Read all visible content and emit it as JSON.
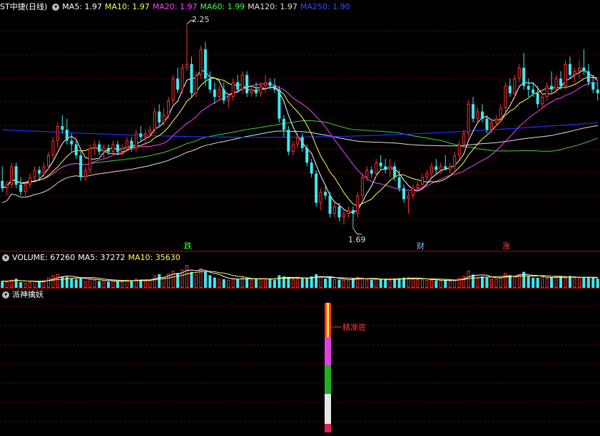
{
  "price": {
    "title": "ST中捷(日线)",
    "ma": [
      {
        "label": "MA5: 1.97",
        "color": "#ffffff"
      },
      {
        "label": "MA10: 1.97",
        "color": "#ffff55"
      },
      {
        "label": "MA20: 1.97",
        "color": "#ff40ff"
      },
      {
        "label": "MA60: 1.99",
        "color": "#40ff40"
      },
      {
        "label": "MA120: 1.97",
        "color": "#e0e0e0"
      },
      {
        "label": "MA250: 1.90",
        "color": "#2030ff"
      }
    ],
    "high_label": "2.25",
    "low_label": "1.69",
    "events": [
      "跌",
      "财",
      "涨"
    ]
  },
  "volume": {
    "label": "VOLUME: 67260",
    "ma5": "MA5: 37272",
    "ma10": "MA10: 35630"
  },
  "indicator": {
    "title": "派神擒妖",
    "annotation": "精准底"
  },
  "colors": {
    "up": "#ff3030",
    "down": "#40e8f0",
    "grid": "#8b0000",
    "divider": "#b00000"
  },
  "chart_data": {
    "type": "candlestick",
    "ylim": [
      1.66,
      2.28
    ],
    "candles": [
      [
        1.82,
        1.86,
        1.79,
        1.8
      ],
      [
        1.8,
        1.82,
        1.78,
        1.81
      ],
      [
        1.81,
        1.87,
        1.8,
        1.86
      ],
      [
        1.86,
        1.87,
        1.8,
        1.81
      ],
      [
        1.81,
        1.83,
        1.78,
        1.79
      ],
      [
        1.79,
        1.82,
        1.78,
        1.81
      ],
      [
        1.81,
        1.84,
        1.8,
        1.83
      ],
      [
        1.83,
        1.86,
        1.82,
        1.85
      ],
      [
        1.85,
        1.86,
        1.82,
        1.84
      ],
      [
        1.84,
        1.87,
        1.83,
        1.86
      ],
      [
        1.86,
        1.9,
        1.85,
        1.89
      ],
      [
        1.89,
        1.94,
        1.88,
        1.93
      ],
      [
        1.93,
        1.98,
        1.91,
        1.97
      ],
      [
        1.97,
        2.0,
        1.95,
        1.96
      ],
      [
        1.96,
        1.99,
        1.92,
        1.93
      ],
      [
        1.93,
        1.95,
        1.9,
        1.92
      ],
      [
        1.92,
        1.93,
        1.88,
        1.89
      ],
      [
        1.89,
        1.9,
        1.82,
        1.83
      ],
      [
        1.83,
        1.86,
        1.82,
        1.85
      ],
      [
        1.85,
        1.92,
        1.84,
        1.91
      ],
      [
        1.91,
        1.93,
        1.89,
        1.92
      ],
      [
        1.92,
        1.93,
        1.89,
        1.9
      ],
      [
        1.9,
        1.92,
        1.88,
        1.91
      ],
      [
        1.91,
        1.92,
        1.89,
        1.9
      ],
      [
        1.9,
        1.93,
        1.89,
        1.92
      ],
      [
        1.92,
        1.93,
        1.89,
        1.9
      ],
      [
        1.9,
        1.92,
        1.89,
        1.91
      ],
      [
        1.91,
        1.94,
        1.9,
        1.93
      ],
      [
        1.93,
        1.94,
        1.9,
        1.91
      ],
      [
        1.91,
        1.96,
        1.9,
        1.95
      ],
      [
        1.95,
        1.97,
        1.93,
        1.94
      ],
      [
        1.94,
        1.96,
        1.92,
        1.95
      ],
      [
        1.95,
        1.97,
        1.94,
        1.96
      ],
      [
        1.96,
        2.02,
        1.95,
        2.01
      ],
      [
        2.01,
        2.03,
        1.97,
        1.98
      ],
      [
        1.98,
        2.02,
        1.97,
        2.0
      ],
      [
        2.0,
        2.05,
        1.99,
        2.04
      ],
      [
        2.04,
        2.11,
        2.03,
        2.1
      ],
      [
        2.1,
        2.13,
        2.06,
        2.07
      ],
      [
        2.07,
        2.14,
        2.06,
        2.13
      ],
      [
        2.13,
        2.25,
        2.12,
        2.14
      ],
      [
        2.14,
        2.16,
        2.05,
        2.06
      ],
      [
        2.06,
        2.12,
        2.05,
        2.11
      ],
      [
        2.11,
        2.19,
        2.1,
        2.18
      ],
      [
        2.18,
        2.2,
        2.08,
        2.1
      ],
      [
        2.1,
        2.12,
        2.06,
        2.07
      ],
      [
        2.07,
        2.09,
        2.03,
        2.05
      ],
      [
        2.05,
        2.08,
        2.04,
        2.07
      ],
      [
        2.07,
        2.09,
        2.03,
        2.04
      ],
      [
        2.04,
        2.06,
        2.02,
        2.05
      ],
      [
        2.05,
        2.1,
        2.04,
        2.09
      ],
      [
        2.09,
        2.11,
        2.06,
        2.07
      ],
      [
        2.07,
        2.12,
        2.06,
        2.11
      ],
      [
        2.11,
        2.12,
        2.05,
        2.06
      ],
      [
        2.06,
        2.08,
        2.05,
        2.07
      ],
      [
        2.07,
        2.09,
        2.05,
        2.06
      ],
      [
        2.06,
        2.09,
        2.05,
        2.08
      ],
      [
        2.08,
        2.11,
        2.06,
        2.09
      ],
      [
        2.09,
        2.1,
        2.07,
        2.08
      ],
      [
        2.08,
        2.1,
        2.06,
        2.07
      ],
      [
        2.07,
        2.08,
        1.98,
        1.99
      ],
      [
        1.99,
        2.0,
        1.94,
        1.96
      ],
      [
        1.96,
        1.97,
        1.89,
        1.9
      ],
      [
        1.9,
        1.93,
        1.89,
        1.92
      ],
      [
        1.92,
        1.95,
        1.91,
        1.94
      ],
      [
        1.94,
        1.95,
        1.9,
        1.91
      ],
      [
        1.91,
        1.92,
        1.86,
        1.87
      ],
      [
        1.87,
        1.88,
        1.83,
        1.84
      ],
      [
        1.84,
        1.85,
        1.75,
        1.76
      ],
      [
        1.76,
        1.8,
        1.74,
        1.79
      ],
      [
        1.79,
        1.81,
        1.77,
        1.78
      ],
      [
        1.78,
        1.79,
        1.72,
        1.73
      ],
      [
        1.73,
        1.76,
        1.72,
        1.75
      ],
      [
        1.75,
        1.76,
        1.71,
        1.72
      ],
      [
        1.72,
        1.74,
        1.7,
        1.73
      ],
      [
        1.73,
        1.75,
        1.72,
        1.74
      ],
      [
        1.74,
        1.75,
        1.69,
        1.73
      ],
      [
        1.73,
        1.79,
        1.72,
        1.78
      ],
      [
        1.78,
        1.84,
        1.77,
        1.83
      ],
      [
        1.83,
        1.86,
        1.82,
        1.85
      ],
      [
        1.85,
        1.86,
        1.83,
        1.84
      ],
      [
        1.84,
        1.88,
        1.83,
        1.87
      ],
      [
        1.87,
        1.89,
        1.85,
        1.86
      ],
      [
        1.86,
        1.88,
        1.84,
        1.85
      ],
      [
        1.85,
        1.88,
        1.83,
        1.86
      ],
      [
        1.86,
        1.87,
        1.82,
        1.83
      ],
      [
        1.83,
        1.85,
        1.79,
        1.8
      ],
      [
        1.8,
        1.81,
        1.76,
        1.77
      ],
      [
        1.77,
        1.79,
        1.73,
        1.78
      ],
      [
        1.78,
        1.81,
        1.77,
        1.8
      ],
      [
        1.8,
        1.82,
        1.79,
        1.81
      ],
      [
        1.81,
        1.84,
        1.8,
        1.83
      ],
      [
        1.83,
        1.85,
        1.82,
        1.84
      ],
      [
        1.84,
        1.87,
        1.83,
        1.86
      ],
      [
        1.86,
        1.88,
        1.84,
        1.85
      ],
      [
        1.85,
        1.87,
        1.84,
        1.86
      ],
      [
        1.86,
        1.89,
        1.85,
        1.85
      ],
      [
        1.85,
        1.87,
        1.84,
        1.86
      ],
      [
        1.86,
        1.9,
        1.85,
        1.89
      ],
      [
        1.89,
        1.93,
        1.88,
        1.92
      ],
      [
        1.92,
        1.96,
        1.91,
        1.95
      ],
      [
        1.95,
        2.04,
        1.94,
        2.03
      ],
      [
        2.03,
        2.05,
        1.98,
        1.99
      ],
      [
        1.99,
        2.02,
        1.98,
        2.01
      ],
      [
        2.01,
        2.03,
        1.98,
        1.99
      ],
      [
        1.99,
        2.0,
        1.95,
        1.96
      ],
      [
        1.96,
        1.99,
        1.95,
        1.98
      ],
      [
        1.98,
        2.0,
        1.97,
        1.99
      ],
      [
        1.99,
        2.03,
        1.98,
        2.02
      ],
      [
        2.02,
        2.09,
        2.01,
        2.08
      ],
      [
        2.08,
        2.1,
        2.05,
        2.06
      ],
      [
        2.06,
        2.11,
        2.05,
        2.1
      ],
      [
        2.1,
        2.14,
        2.09,
        2.13
      ],
      [
        2.13,
        2.17,
        2.07,
        2.08
      ],
      [
        2.08,
        2.1,
        2.05,
        2.07
      ],
      [
        2.07,
        2.09,
        2.05,
        2.06
      ],
      [
        2.06,
        2.08,
        2.02,
        2.03
      ],
      [
        2.03,
        2.06,
        2.02,
        2.05
      ],
      [
        2.05,
        2.09,
        2.04,
        2.08
      ],
      [
        2.08,
        2.12,
        2.06,
        2.07
      ],
      [
        2.07,
        2.11,
        2.06,
        2.1
      ],
      [
        2.1,
        2.12,
        2.07,
        2.08
      ],
      [
        2.08,
        2.15,
        2.07,
        2.14
      ],
      [
        2.14,
        2.16,
        2.1,
        2.11
      ],
      [
        2.11,
        2.13,
        2.09,
        2.12
      ],
      [
        2.12,
        2.15,
        2.1,
        2.13
      ],
      [
        2.13,
        2.18,
        2.11,
        2.12
      ],
      [
        2.12,
        2.14,
        2.08,
        2.09
      ],
      [
        2.09,
        2.11,
        2.06,
        2.07
      ],
      [
        2.07,
        2.09,
        2.04,
        2.06
      ]
    ],
    "volume_max": 100,
    "volume": [
      30,
      28,
      35,
      40,
      25,
      22,
      26,
      30,
      28,
      32,
      45,
      55,
      60,
      50,
      48,
      42,
      38,
      45,
      30,
      40,
      35,
      30,
      28,
      27,
      32,
      30,
      28,
      35,
      30,
      40,
      36,
      32,
      34,
      55,
      60,
      48,
      62,
      75,
      65,
      80,
      100,
      70,
      60,
      85,
      70,
      55,
      45,
      40,
      38,
      35,
      40,
      38,
      45,
      42,
      36,
      38,
      40,
      42,
      38,
      35,
      55,
      50,
      48,
      38,
      40,
      42,
      45,
      50,
      60,
      48,
      40,
      45,
      38,
      36,
      34,
      32,
      40,
      48,
      45,
      36,
      35,
      40,
      38,
      36,
      35,
      38,
      42,
      45,
      48,
      40,
      38,
      36,
      34,
      35,
      32,
      30,
      34,
      30,
      36,
      44,
      52,
      75,
      58,
      48,
      50,
      45,
      40,
      38,
      46,
      65,
      55,
      50,
      60,
      70,
      50,
      45,
      44,
      48,
      42,
      46,
      50,
      48,
      44,
      52,
      46,
      42,
      45,
      48,
      44,
      40
    ]
  }
}
